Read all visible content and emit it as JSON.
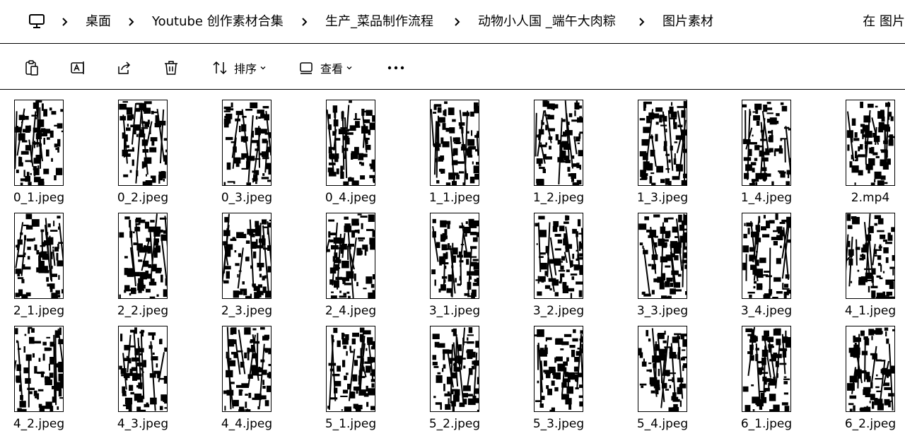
{
  "breadcrumb": {
    "items": [
      "桌面",
      "Youtube 创作素材合集",
      "生产_菜品制作流程",
      "动物小人国 _端午大肉粽",
      "图片素材"
    ],
    "search_placeholder": "在 图片"
  },
  "toolbar": {
    "sort_label": "排序",
    "view_label": "查看"
  },
  "files": [
    {
      "name": "0_1.jpeg"
    },
    {
      "name": "0_2.jpeg"
    },
    {
      "name": "0_3.jpeg"
    },
    {
      "name": "0_4.jpeg"
    },
    {
      "name": "1_1.jpeg"
    },
    {
      "name": "1_2.jpeg"
    },
    {
      "name": "1_3.jpeg"
    },
    {
      "name": "1_4.jpeg"
    },
    {
      "name": "2.mp4"
    },
    {
      "name": "2_1.jpeg"
    },
    {
      "name": "2_2.jpeg"
    },
    {
      "name": "2_3.jpeg"
    },
    {
      "name": "2_4.jpeg"
    },
    {
      "name": "3_1.jpeg"
    },
    {
      "name": "3_2.jpeg"
    },
    {
      "name": "3_3.jpeg"
    },
    {
      "name": "3_4.jpeg"
    },
    {
      "name": "4_1.jpeg"
    },
    {
      "name": "4_2.jpeg"
    },
    {
      "name": "4_3.jpeg"
    },
    {
      "name": "4_4.jpeg"
    },
    {
      "name": "5_1.jpeg"
    },
    {
      "name": "5_2.jpeg"
    },
    {
      "name": "5_3.jpeg"
    },
    {
      "name": "5_4.jpeg"
    },
    {
      "name": "6_1.jpeg"
    },
    {
      "name": "6_2.jpeg"
    }
  ]
}
